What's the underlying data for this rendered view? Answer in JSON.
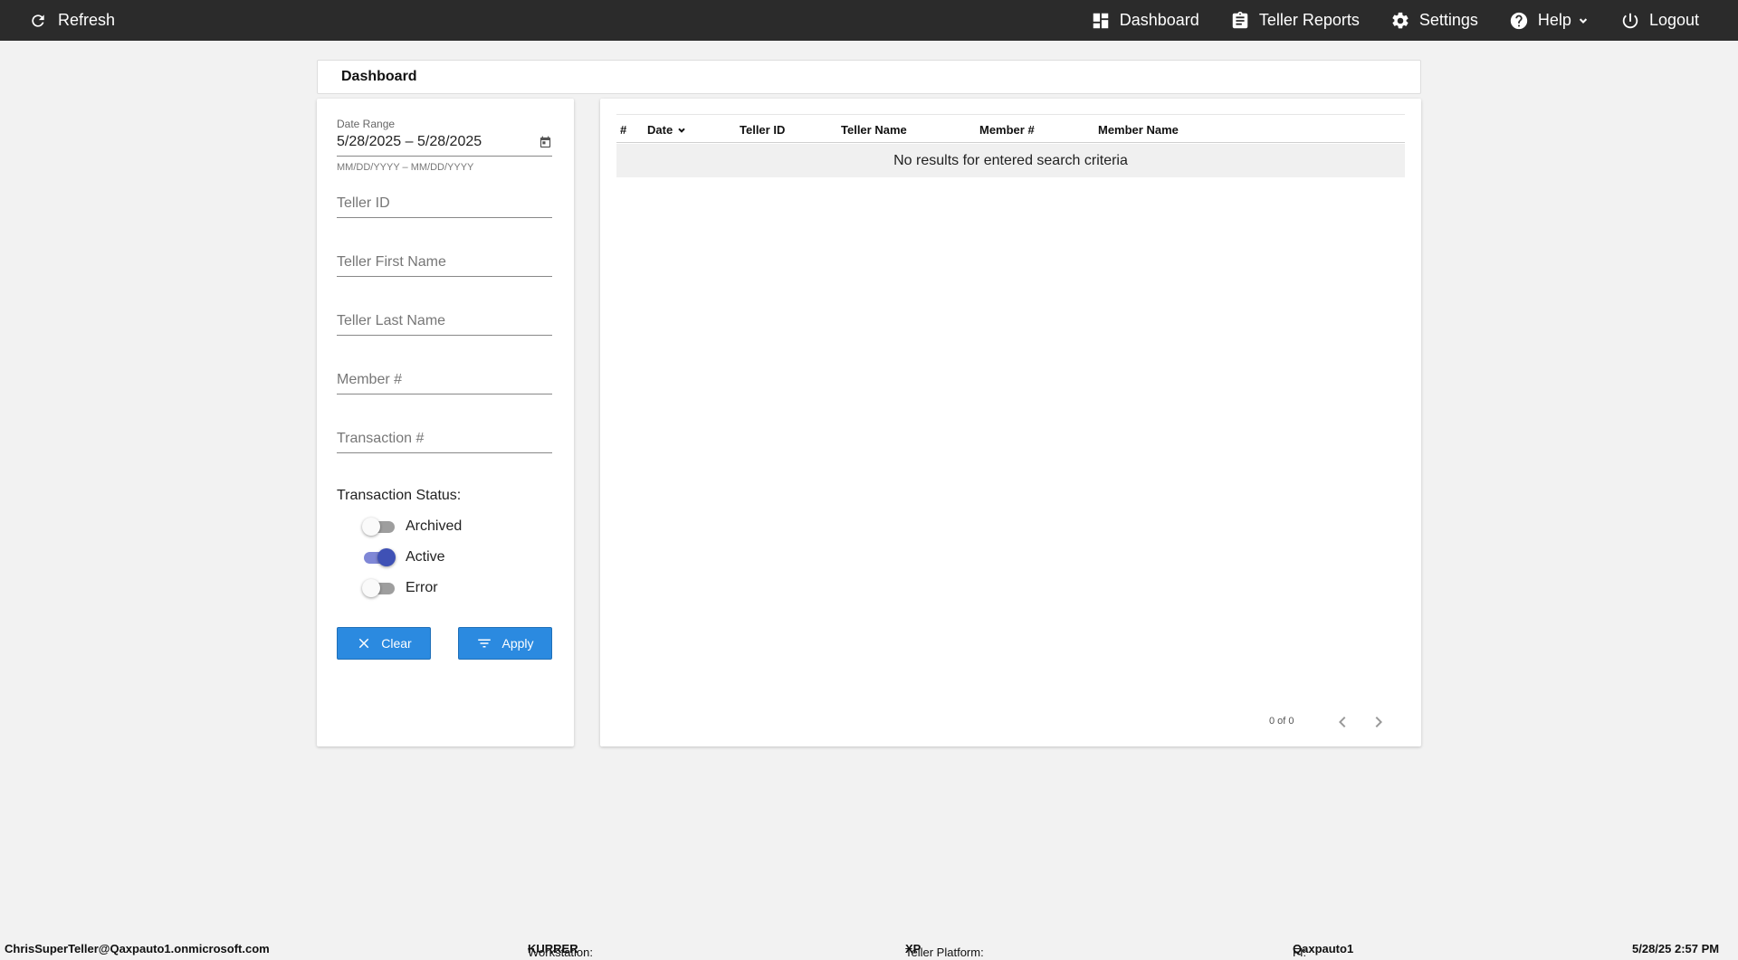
{
  "topbar": {
    "refresh_label": "Refresh",
    "nav": {
      "dashboard": "Dashboard",
      "teller_reports": "Teller Reports",
      "settings": "Settings",
      "help": "Help",
      "logout": "Logout"
    }
  },
  "page_title": "Dashboard",
  "filters": {
    "date_range_label": "Date Range",
    "date_range_value": "5/28/2025 – 5/28/2025",
    "date_range_hint": "MM/DD/YYYY – MM/DD/YYYY",
    "teller_id_placeholder": "Teller ID",
    "teller_first_name_placeholder": "Teller First Name",
    "teller_last_name_placeholder": "Teller Last Name",
    "member_number_placeholder": "Member #",
    "transaction_number_placeholder": "Transaction #",
    "status_label": "Transaction Status:",
    "statuses": [
      {
        "label": "Archived",
        "on": false
      },
      {
        "label": "Active",
        "on": true
      },
      {
        "label": "Error",
        "on": false
      }
    ],
    "clear_label": "Clear",
    "apply_label": "Apply"
  },
  "results": {
    "columns": [
      "#",
      "Date",
      "Teller ID",
      "Teller Name",
      "Member #",
      "Member Name"
    ],
    "empty_message": "No results for entered search criteria",
    "pager_count": "0 of 0"
  },
  "footer": {
    "user": "ChrisSuperTeller@Qaxpauto1.onmicrosoft.com",
    "workstation_label": "Workstation:",
    "workstation_value": "KURRER",
    "platform_label": "Teller Platform:",
    "platform_value": "XP",
    "fi_label": "FI:",
    "fi_value": "Qaxpauto1",
    "timestamp": "5/28/25 2:57 PM"
  },
  "colors": {
    "topbar": "#2b2b2b",
    "button": "#2b8ae0",
    "toggle_on": "#3f51b5"
  }
}
